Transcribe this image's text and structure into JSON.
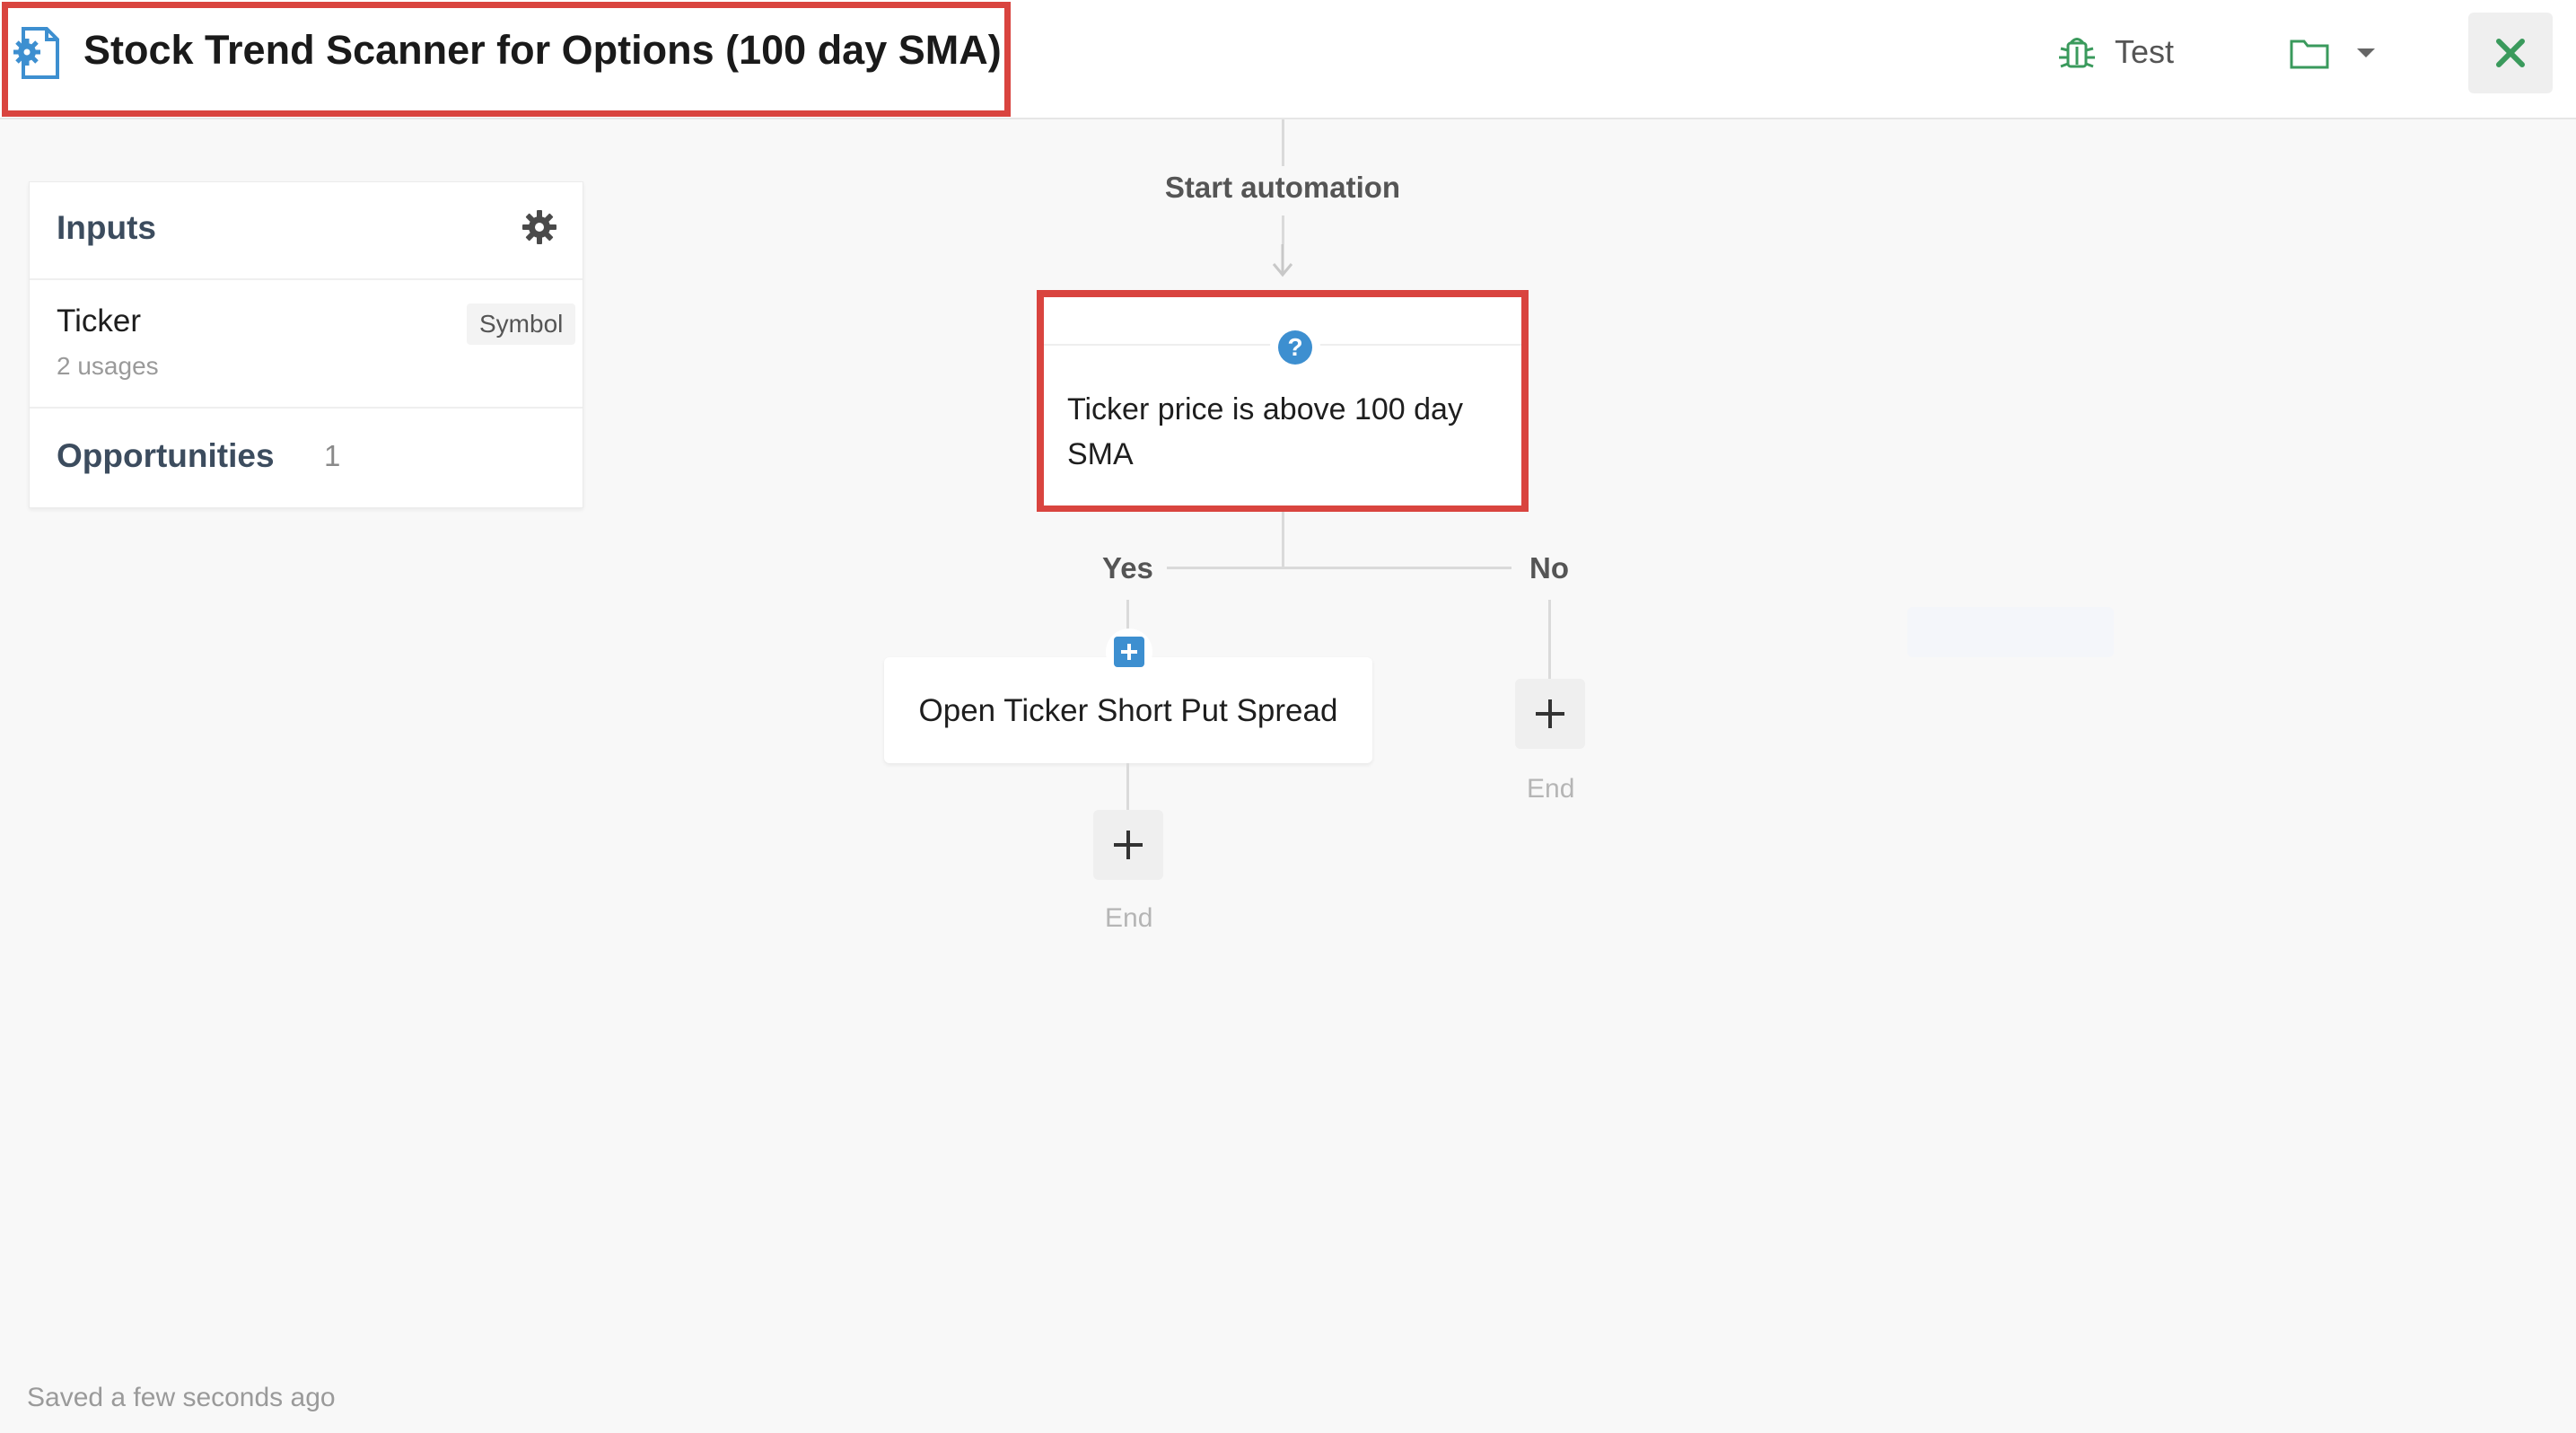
{
  "header": {
    "title": "Stock Trend Scanner for Options (100 day SMA)",
    "test_label": "Test"
  },
  "inputs_panel": {
    "heading": "Inputs",
    "items": [
      {
        "name": "Ticker",
        "type": "Symbol",
        "usages": "2 usages"
      }
    ],
    "opportunities_label": "Opportunities",
    "opportunities_count": "1"
  },
  "flow": {
    "start_label": "Start automation",
    "condition_text": "Ticker price is above 100 day SMA",
    "yes_label": "Yes",
    "no_label": "No",
    "yes_action": "Open Ticker Short Put Spread",
    "yes_end_label": "End",
    "no_end_label": "End"
  },
  "footer": {
    "saved_status": "Saved a few seconds ago"
  },
  "colors": {
    "highlight": "#d9443f",
    "accent_blue": "#3d8fd0",
    "accent_green": "#3a9a5c"
  },
  "icons": {
    "app": "automation-gear-icon",
    "test": "bug-icon",
    "folder": "folder-icon",
    "dropdown": "caret-down-icon",
    "close": "close-icon",
    "settings": "gear-icon",
    "condition": "help-icon",
    "action": "plus-square-icon",
    "add": "plus-icon",
    "arrow": "arrow-down-icon"
  }
}
